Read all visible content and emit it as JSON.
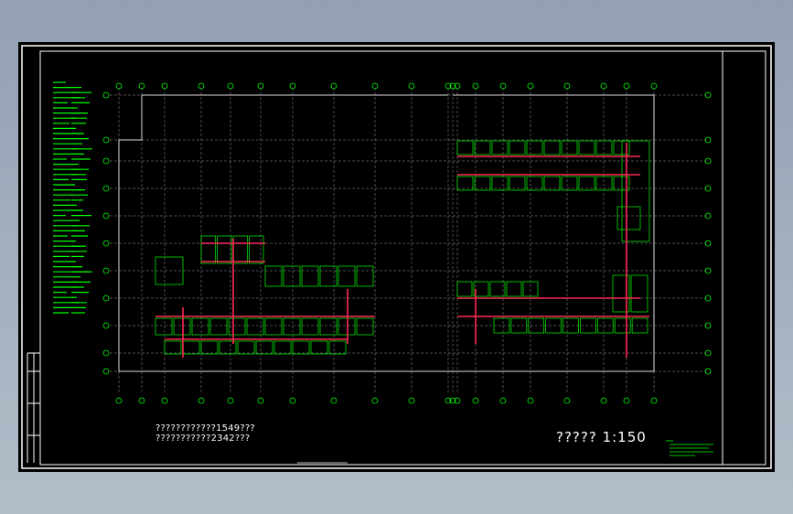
{
  "drawing": {
    "note_line_1": "????????????1549???",
    "note_line_2": "???????????2342???",
    "title_scale": "????? 1:150",
    "colors": {
      "background": "#000000",
      "frame": "#ffffff",
      "grid": "#c8c8c8",
      "walls": "#00ff00",
      "ducts": "#ff2a55",
      "axis_bubbles": "#00ff00"
    },
    "icons": [
      "floor-plan",
      "grid-axis-bubble",
      "title-block",
      "legend-text-block"
    ]
  }
}
